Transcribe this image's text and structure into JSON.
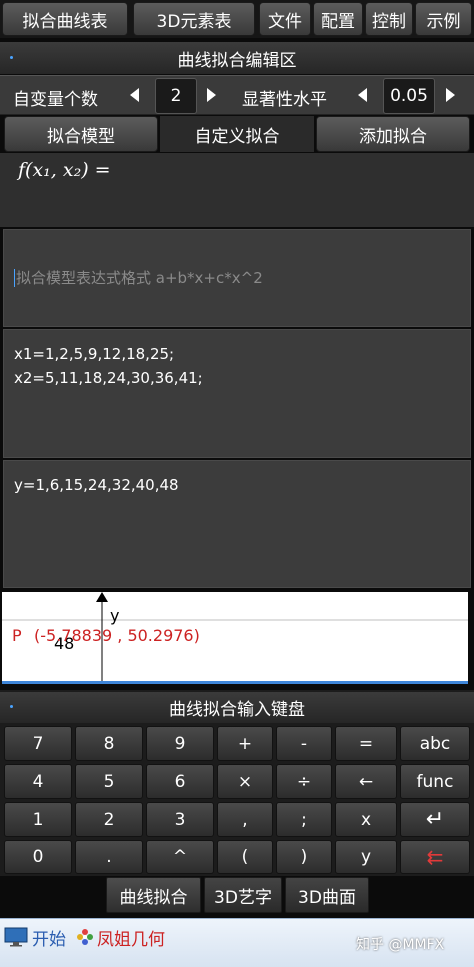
{
  "top_tabs": {
    "fit_curve_table": "拟合曲线表",
    "elements_3d": "3D元素表",
    "file": "文件",
    "config": "配置",
    "control": "控制",
    "examples": "示例"
  },
  "editor": {
    "title": "曲线拟合编辑区",
    "var_count_label": "自变量个数",
    "var_count_value": "2",
    "significance_label": "显著性水平",
    "significance_value": "0.05",
    "fit_model_btn": "拟合模型",
    "custom_fit_label": "自定义拟合",
    "add_fit_btn": "添加拟合",
    "formula_f": "f",
    "formula_rest": "(x₁, x₂) =",
    "expr_placeholder": "拟合模型表达式格式 a+b*x+c*x^2",
    "x_data": "x1=1,2,5,9,12,18,25;\nx2=5,11,18,24,30,36,41;",
    "y_data": "y=1,6,15,24,32,40,48"
  },
  "graph": {
    "axis_label_y": "y",
    "tick_label": "48",
    "point_label": "P",
    "point_coords": "(-5.78839 , 50.2976)",
    "point_color": "#cc2222"
  },
  "keyboard": {
    "title": "曲线拟合输入键盘",
    "rows": [
      [
        "7",
        "8",
        "9",
        "+",
        "-",
        "=",
        "abc"
      ],
      [
        "4",
        "5",
        "6",
        "×",
        "÷",
        "←",
        "func"
      ],
      [
        "1",
        "2",
        "3",
        ",",
        ";",
        "x",
        "↵"
      ],
      [
        "0",
        ".",
        "^",
        "(",
        ")",
        "y",
        "⇇"
      ]
    ]
  },
  "bottom_tabs": {
    "curve_fit": "曲线拟合",
    "art_3d": "3D艺字",
    "surface_3d": "3D曲面"
  },
  "taskbar": {
    "start": "开始",
    "app": "凤姐几何",
    "watermark": "知乎 @MMFX"
  },
  "icons": {
    "start": "monitor-icon",
    "app": "flower-icon"
  },
  "colors": {
    "accent_blue": "#4aa3ff",
    "red_text": "#cc2222"
  }
}
